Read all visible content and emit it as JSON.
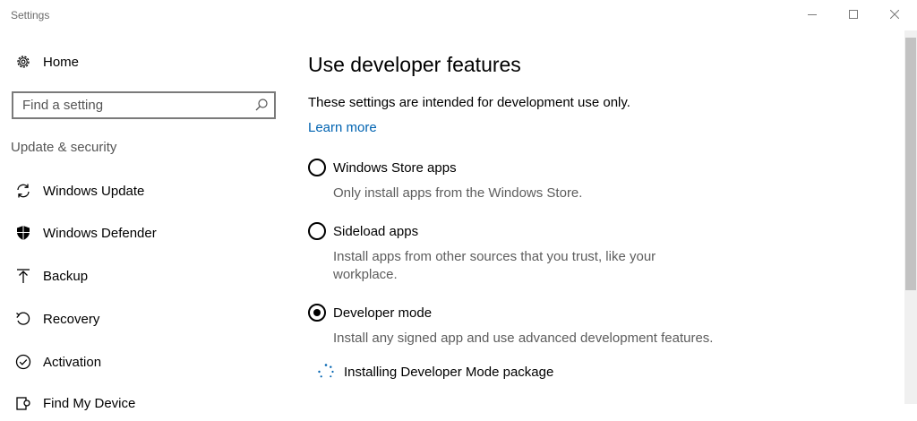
{
  "window": {
    "title": "Settings"
  },
  "sidebar": {
    "home_label": "Home",
    "search_placeholder": "Find a setting",
    "section_heading": "Update & security",
    "items": [
      {
        "label": "Windows Update",
        "icon": "sync-icon"
      },
      {
        "label": "Windows Defender",
        "icon": "shield-icon"
      },
      {
        "label": "Backup",
        "icon": "backup-icon"
      },
      {
        "label": "Recovery",
        "icon": "recovery-icon"
      },
      {
        "label": "Activation",
        "icon": "check-circle-icon"
      },
      {
        "label": "Find My Device",
        "icon": "find-device-icon"
      }
    ]
  },
  "main": {
    "title": "Use developer features",
    "intro": "These settings are intended for development use only.",
    "learn_more": "Learn more",
    "options": [
      {
        "label": "Windows Store apps",
        "description": "Only install apps from the Windows Store.",
        "selected": false
      },
      {
        "label": "Sideload apps",
        "description_line1": "Install apps from other sources that you trust, like your",
        "description_line2": "workplace.",
        "selected": false
      },
      {
        "label": "Developer mode",
        "description": "Install any signed app and use advanced development features.",
        "selected": true
      }
    ],
    "status": "Installing Developer Mode package"
  },
  "colors": {
    "accent": "#0063b1",
    "secondary_text": "#5d5d5d"
  }
}
